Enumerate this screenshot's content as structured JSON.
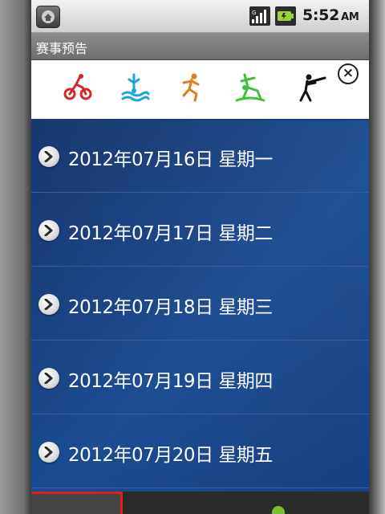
{
  "status_bar": {
    "time": "5:52",
    "ampm": "AM"
  },
  "title_bar": {
    "title": "赛事预告"
  },
  "banner": {
    "pictograms": [
      {
        "name": "cycling-icon",
        "color": "#d8242b"
      },
      {
        "name": "diving-icon",
        "color": "#1aa6d9"
      },
      {
        "name": "athletics-icon",
        "color": "#e07b22"
      },
      {
        "name": "gymnastics-icon",
        "color": "#3fbf3a"
      },
      {
        "name": "shooting-icon",
        "color": "#111111"
      }
    ],
    "close_label": "×"
  },
  "schedule": {
    "items": [
      {
        "label": "2012年07月16日 星期一"
      },
      {
        "label": "2012年07月17日 星期二"
      },
      {
        "label": "2012年07月18日 星期三"
      },
      {
        "label": "2012年07月19日 星期四"
      },
      {
        "label": "2012年07月20日 星期五"
      }
    ]
  },
  "colors": {
    "list_background": "#16407f",
    "selection_highlight": "#e01b1b"
  }
}
